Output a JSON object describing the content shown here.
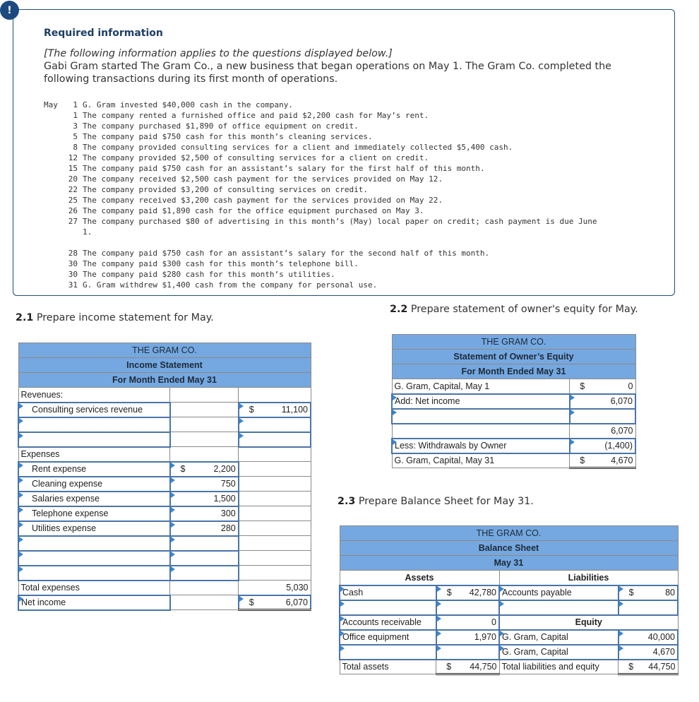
{
  "info": {
    "badge": "!",
    "title": "Required information",
    "italic_note": "[The following information applies to the questions displayed below.]",
    "description": "Gabi Gram started The Gram Co., a new business that began operations on May 1. The Gram Co. completed the following transactions during its first month of operations.",
    "month": "May",
    "transactions": [
      {
        "day": "1",
        "text": "G. Gram invested $40,000 cash in the company."
      },
      {
        "day": "1",
        "text": "The company rented a furnished office and paid $2,200 cash for May’s rent."
      },
      {
        "day": "3",
        "text": "The company purchased $1,890 of office equipment on credit."
      },
      {
        "day": "5",
        "text": "The company paid $750 cash for this month’s cleaning services."
      },
      {
        "day": "8",
        "text": "The company provided consulting services for a client and immediately collected $5,400 cash."
      },
      {
        "day": "12",
        "text": "The company provided $2,500 of consulting services for a client on credit."
      },
      {
        "day": "15",
        "text": "The company paid $750 cash for an assistant’s salary for the first half of this month."
      },
      {
        "day": "20",
        "text": "The company received $2,500 cash payment for the services provided on May 12."
      },
      {
        "day": "22",
        "text": "The company provided $3,200 of consulting services on credit."
      },
      {
        "day": "25",
        "text": "The company received $3,200 cash payment for the services provided on May 22."
      },
      {
        "day": "26",
        "text": "The company paid $1,890 cash for the office equipment purchased on May 3."
      },
      {
        "day": "27",
        "text": "The company purchased $80 of advertising in this month’s (May) local paper on credit; cash payment is due June"
      },
      {
        "day": "",
        "text": "1."
      },
      {
        "day": "",
        "text": ""
      },
      {
        "day": "28",
        "text": "The company paid $750 cash for an assistant’s salary for the second half of this month."
      },
      {
        "day": "30",
        "text": "The company paid $300 cash for this month’s telephone bill."
      },
      {
        "day": "30",
        "text": "The company paid $280 cash for this month’s utilities."
      },
      {
        "day": "31",
        "text": "G. Gram withdrew $1,400 cash from the company for personal use."
      }
    ]
  },
  "income_statement": {
    "heading_num": "2.1",
    "heading_text": " Prepare income statement for May.",
    "company": "THE GRAM CO.",
    "title": "Income Statement",
    "period": "For Month Ended May 31",
    "revenues_label": "Revenues:",
    "revenue_rows": [
      {
        "label": "Consulting services revenue",
        "dollar": "$",
        "amount": "11,100"
      },
      {
        "label": "",
        "dollar": "",
        "amount": ""
      },
      {
        "label": "",
        "dollar": "",
        "amount": ""
      }
    ],
    "expenses_label": "Expenses",
    "expense_rows": [
      {
        "label": "Rent expense",
        "dollar": "$",
        "amount": "2,200"
      },
      {
        "label": "Cleaning expense",
        "dollar": "",
        "amount": "750"
      },
      {
        "label": "Salaries expense",
        "dollar": "",
        "amount": "1,500"
      },
      {
        "label": "Telephone expense",
        "dollar": "",
        "amount": "300"
      },
      {
        "label": "Utilities expense",
        "dollar": "",
        "amount": "280"
      },
      {
        "label": "",
        "dollar": "",
        "amount": ""
      },
      {
        "label": "",
        "dollar": "",
        "amount": ""
      },
      {
        "label": "",
        "dollar": "",
        "amount": ""
      }
    ],
    "total_expenses_label": "Total expenses",
    "total_expenses": "5,030",
    "net_income_label": "Net income",
    "net_income_dollar": "$",
    "net_income": "6,070"
  },
  "owners_equity": {
    "heading_num": "2.2",
    "heading_text": " Prepare statement of owner's equity for May.",
    "company": "THE GRAM CO.",
    "title": "Statement of Owner’s Equity",
    "period": "For Month Ended May 31",
    "rows": [
      {
        "label": "G. Gram, Capital, May 1",
        "dollar": "$",
        "amount": "0"
      },
      {
        "label": "Add: Net income",
        "dollar": "",
        "amount": "6,070"
      },
      {
        "label": "",
        "dollar": "",
        "amount": ""
      },
      {
        "label": "",
        "dollar": "",
        "amount": "6,070"
      },
      {
        "label": "Less: Withdrawals by Owner",
        "dollar": "",
        "amount": "(1,400)"
      },
      {
        "label": "G. Gram, Capital, May 31",
        "dollar": "$",
        "amount": "4,670"
      }
    ]
  },
  "balance_sheet": {
    "heading_num": "2.3",
    "heading_text": " Prepare Balance Sheet for May 31.",
    "company": "THE GRAM CO.",
    "title": "Balance Sheet",
    "period": "May 31",
    "assets_label": "Assets",
    "liabilities_label": "Liabilities",
    "equity_label": "Equity",
    "assets": [
      {
        "label": "Cash",
        "dollar": "$",
        "amount": "42,780"
      },
      {
        "label": "",
        "dollar": "",
        "amount": ""
      },
      {
        "label": "Accounts receivable",
        "dollar": "",
        "amount": "0"
      },
      {
        "label": "Office equipment",
        "dollar": "",
        "amount": "1,970"
      },
      {
        "label": "",
        "dollar": "",
        "amount": ""
      }
    ],
    "liabilities": [
      {
        "label": "Accounts payable",
        "dollar": "$",
        "amount": "80"
      },
      {
        "label": "",
        "dollar": "",
        "amount": ""
      }
    ],
    "equity": [
      {
        "label": "G. Gram, Capital",
        "dollar": "",
        "amount": "40,000"
      },
      {
        "label": "G. Gram, Capital",
        "dollar": "",
        "amount": "4,670"
      }
    ],
    "total_assets_label": "Total assets",
    "total_assets_dollar": "$",
    "total_assets": "44,750",
    "total_le_label": "Total liabilities and equity",
    "total_le_dollar": "$",
    "total_le": "44,750"
  }
}
